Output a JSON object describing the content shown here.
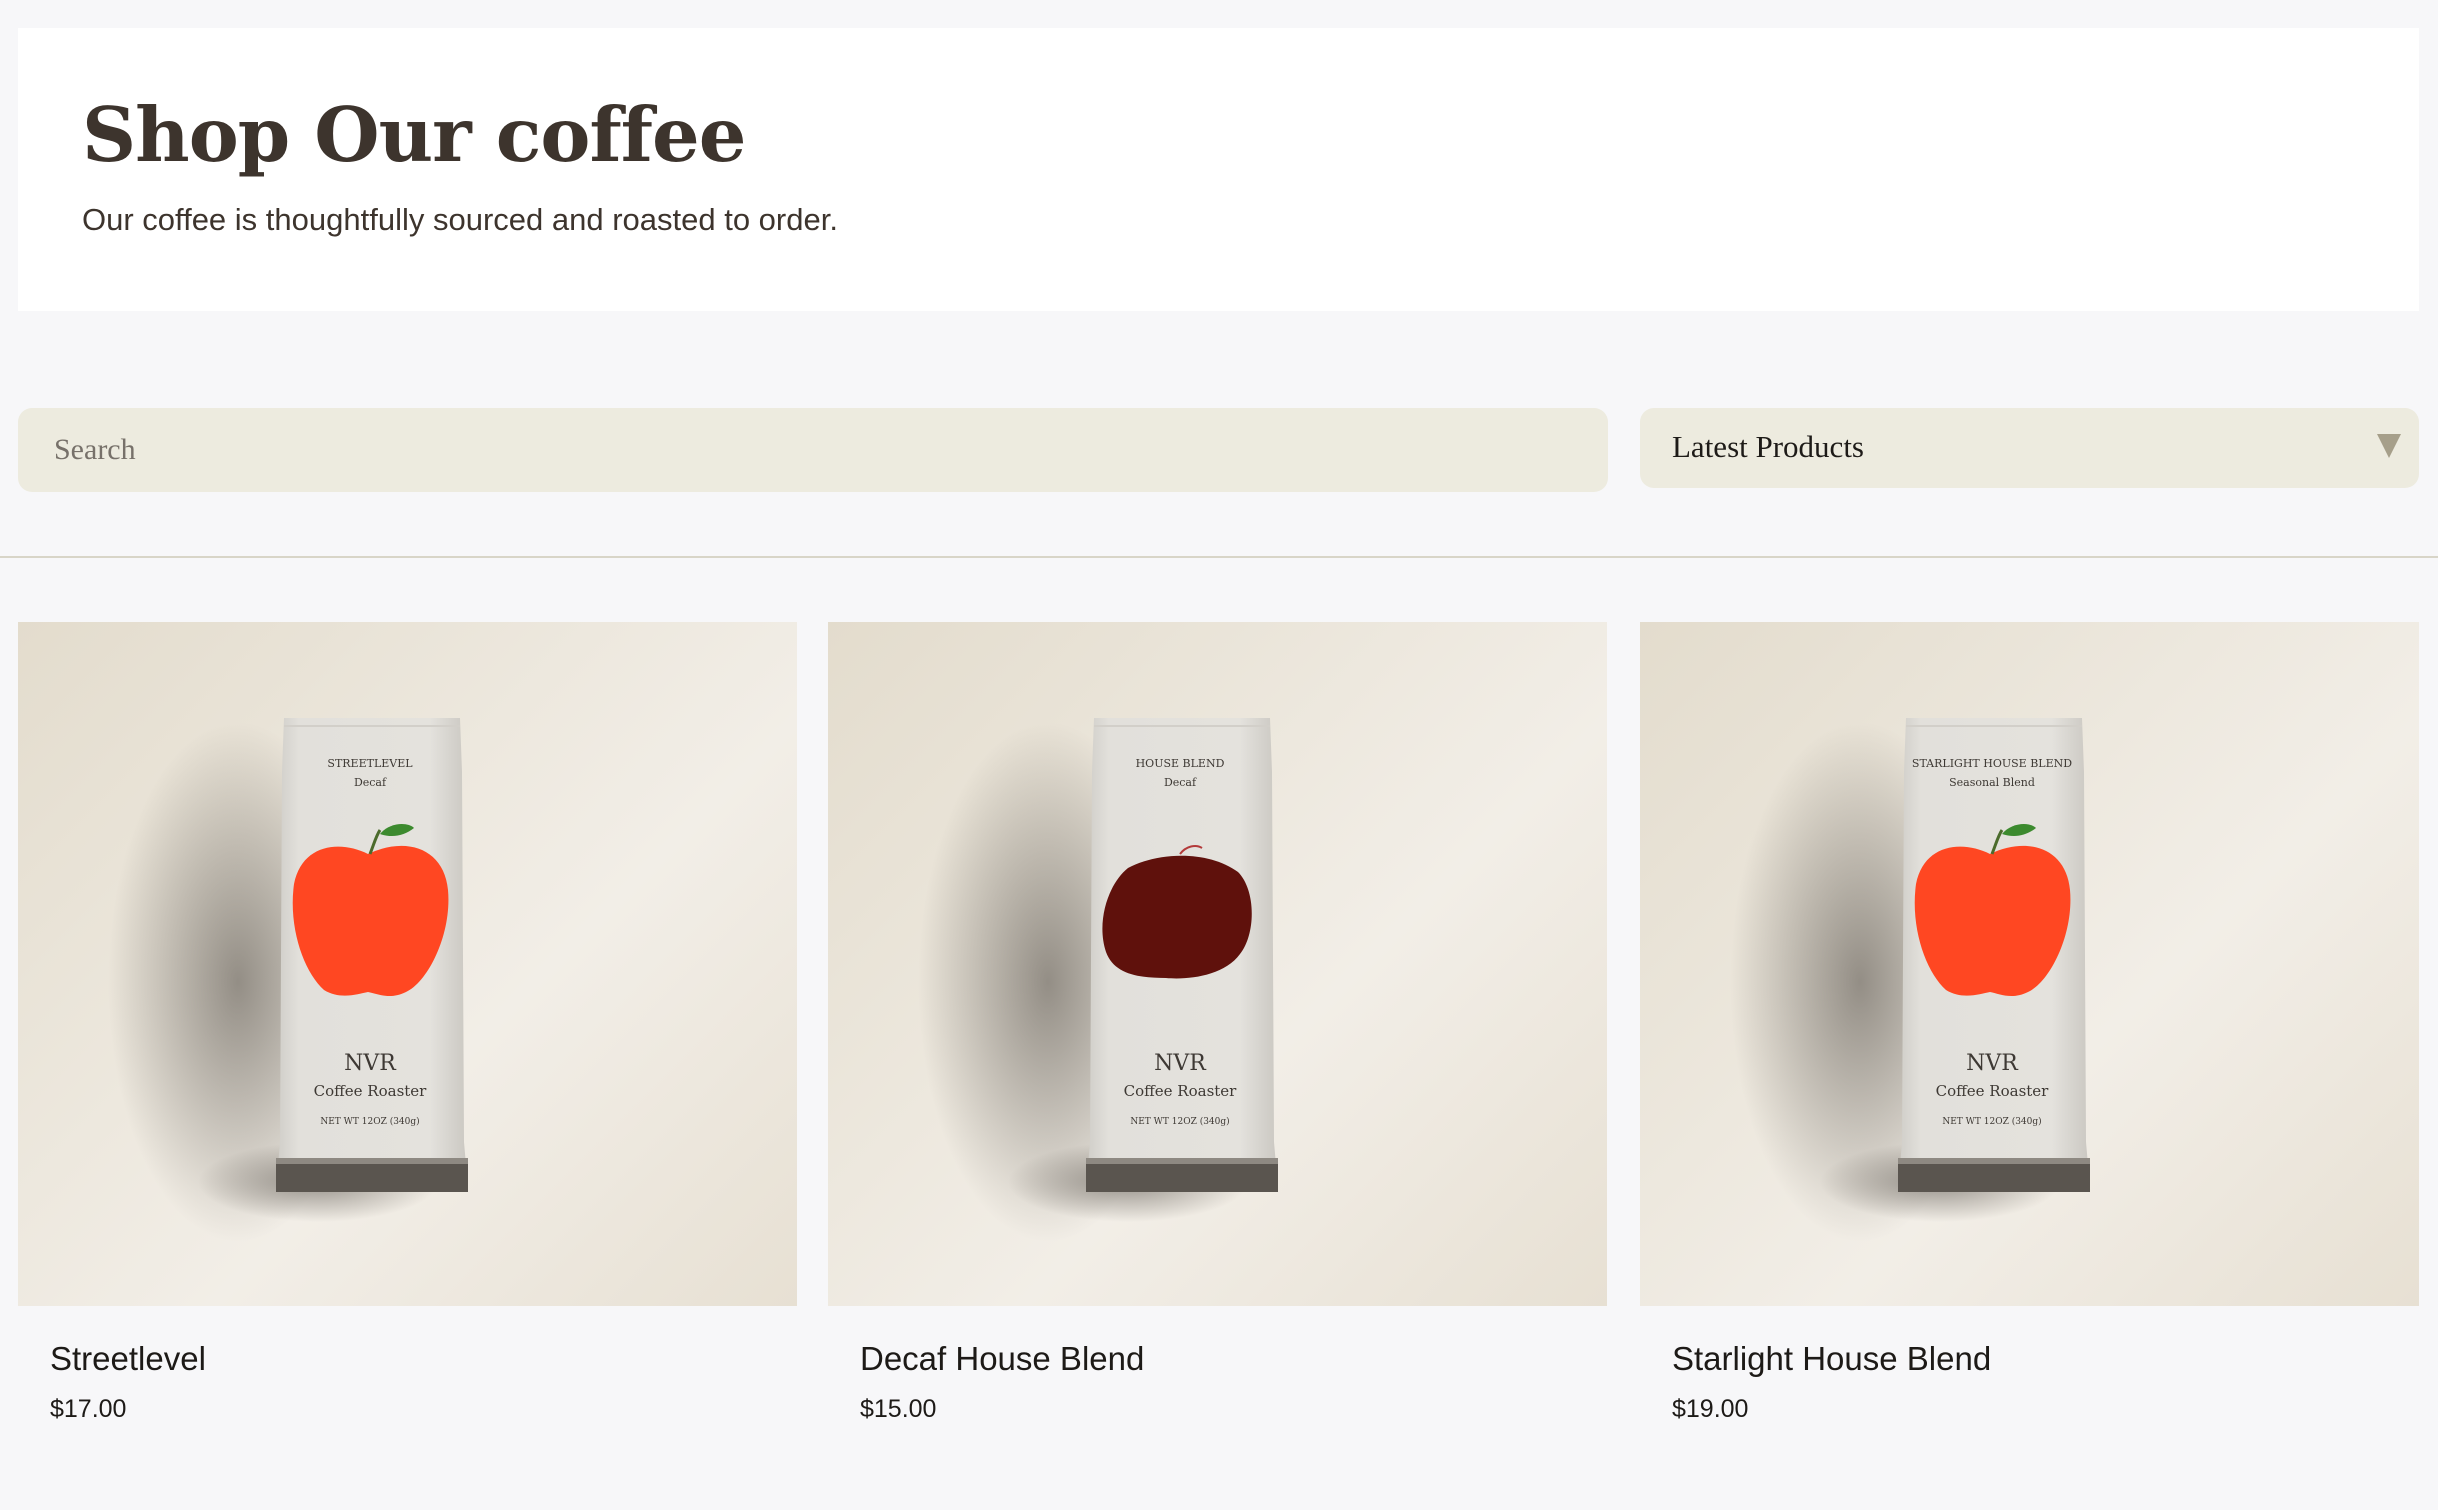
{
  "header": {
    "title": "Shop Our coffee",
    "subtitle": "Our coffee is thoughtfully sourced and roasted to order."
  },
  "search": {
    "placeholder": "Search",
    "value": ""
  },
  "sort": {
    "selected": "Latest Products",
    "icon": "triangle-down-icon"
  },
  "products": [
    {
      "name": "Streetlevel",
      "price": "$17.00",
      "bag": {
        "line1": "STREETLEVEL",
        "line2": "Decaf",
        "brand": "NVR",
        "tagline": "Coffee Roaster",
        "weight": "NET WT 12OZ (340g)",
        "fruit_color": "#ff4722",
        "fruit": "apple"
      }
    },
    {
      "name": "Decaf House Blend",
      "price": "$15.00",
      "bag": {
        "line1": "HOUSE BLEND",
        "line2": "Decaf",
        "brand": "NVR",
        "tagline": "Coffee Roaster",
        "weight": "NET WT 12OZ (340g)",
        "fruit_color": "#5f110c",
        "fruit": "plum"
      }
    },
    {
      "name": "Starlight House Blend",
      "price": "$19.00",
      "bag": {
        "line1": "STARLIGHT HOUSE BLEND",
        "line2": "Seasonal Blend",
        "brand": "NVR",
        "tagline": "Coffee Roaster",
        "weight": "NET WT 12OZ (340g)",
        "fruit_color": "#ff4722",
        "fruit": "apple"
      }
    }
  ]
}
